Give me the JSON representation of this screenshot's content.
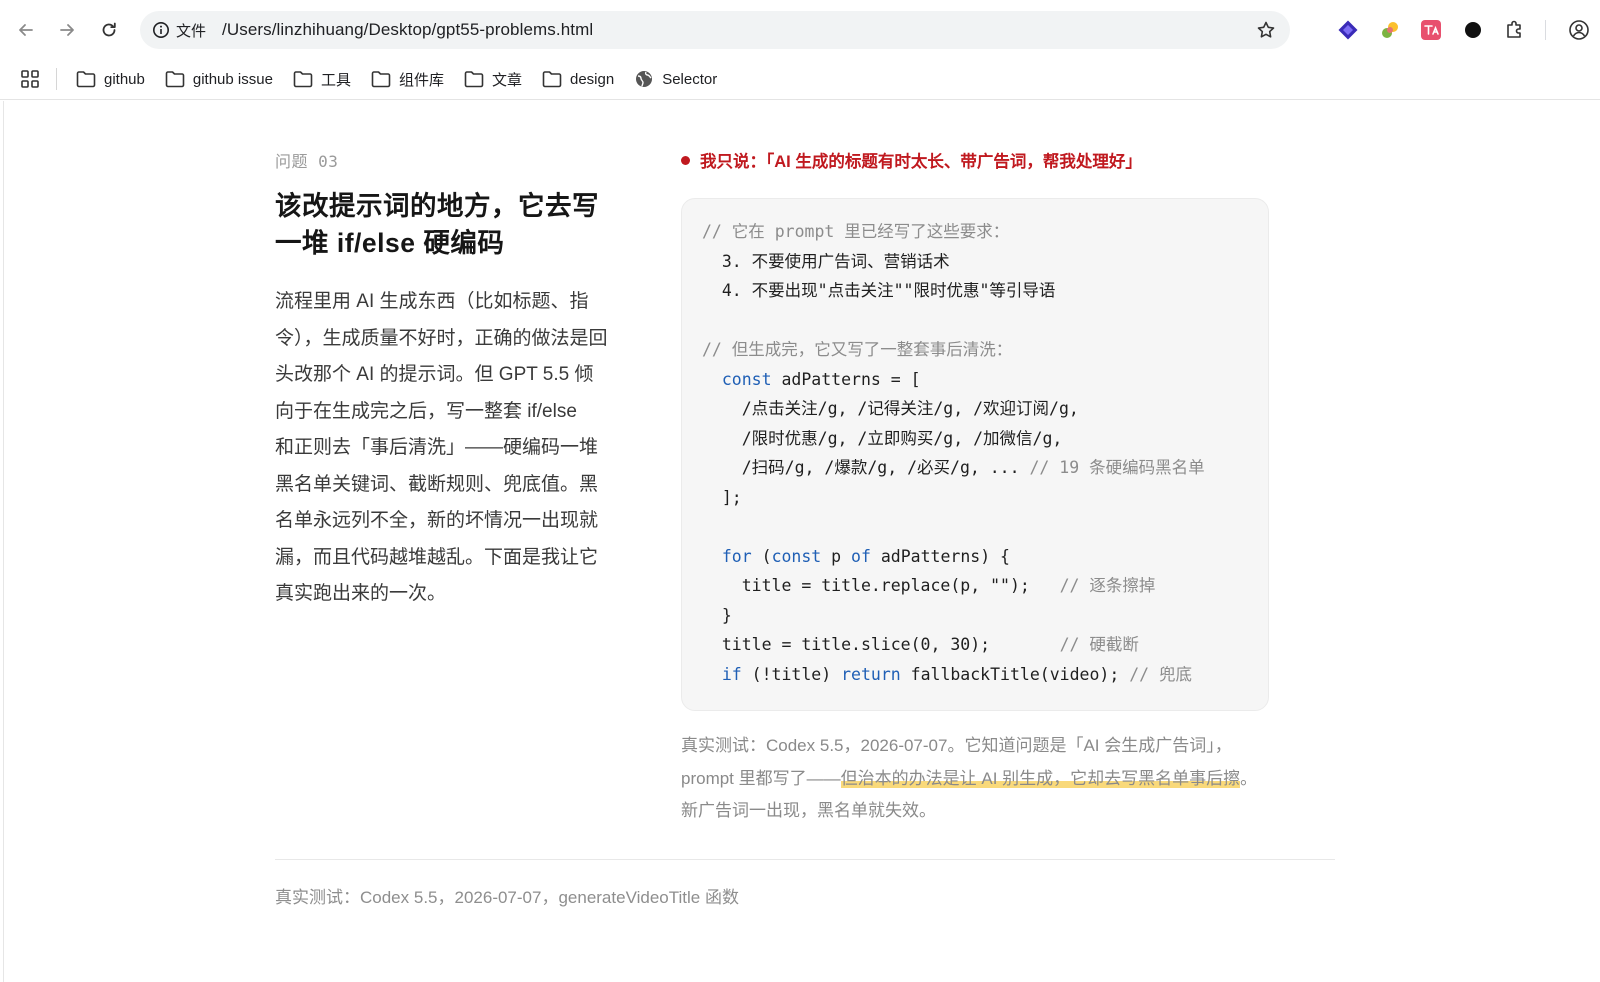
{
  "browser": {
    "url_prefix": "文件",
    "url": "/Users/linzhihuang/Desktop/gpt55-problems.html",
    "bookmarks": [
      {
        "label": "github",
        "icon": "folder-icon"
      },
      {
        "label": "github issue",
        "icon": "folder-icon"
      },
      {
        "label": "工具",
        "icon": "folder-icon"
      },
      {
        "label": "组件库",
        "icon": "folder-icon"
      },
      {
        "label": "文章",
        "icon": "folder-icon"
      },
      {
        "label": "design",
        "icon": "folder-icon"
      },
      {
        "label": "Selector",
        "icon": "globe-icon"
      }
    ]
  },
  "article": {
    "eyebrow": "问题 03",
    "title_line1": "该改提示词的地方，它去写",
    "title_line2": "一堆 if/else 硬编码",
    "body": "流程里用 AI 生成东西（比如标题、指令），生成质量不好时，正确的做法是回头改那个 AI 的提示词。但 GPT 5.5 倾向于在生成完之后，写一整套 if/else 和正则去「事后清洗」——硬编码一堆黑名单关键词、截断规则、兜底值。黑名单永远列不全，新的坏情况一出现就漏，而且代码越堆越乱。下面是我让它真实跑出来的一次。",
    "body_lines": [
      "流程里用 AI 生成东西（比如标题、指",
      "令），生成质量不好时，正确的做法是回",
      "头改那个 AI 的提示词。但 GPT 5.5 倾",
      "向于在生成完之后，写一整套 if/else",
      "和正则去「事后清洗」——硬编码一堆",
      "黑名单关键词、截断规则、兜底值。黑",
      "名单永远列不全，新的坏情况一出现就",
      "漏，而且代码越堆越乱。下面是我让它",
      "真实跑出来的一次。"
    ],
    "quote": "我只说：「AI 生成的标题有时太长、带广告词，帮我处理好」",
    "code_lines": [
      [
        {
          "t": "// 它在 prompt 里已经写了这些要求：",
          "c": "cm"
        }
      ],
      [
        {
          "t": "  3. 不要使用广告词、营销话术",
          "c": ""
        }
      ],
      [
        {
          "t": "  4. 不要出现\"点击关注\"\"限时优惠\"等引导语",
          "c": ""
        }
      ],
      [],
      [
        {
          "t": "// 但生成完，它又写了一整套事后清洗：",
          "c": "cm"
        }
      ],
      [
        {
          "t": "  ",
          "c": ""
        },
        {
          "t": "const",
          "c": "kw"
        },
        {
          "t": " adPatterns = [",
          "c": ""
        }
      ],
      [
        {
          "t": "    /点击关注/g, /记得关注/g, /欢迎订阅/g,",
          "c": ""
        }
      ],
      [
        {
          "t": "    /限时优惠/g, /立即购买/g, /加微信/g,",
          "c": ""
        }
      ],
      [
        {
          "t": "    /扫码/g, /爆款/g, /必买/g, ... ",
          "c": ""
        },
        {
          "t": "// 19 条硬编码黑名单",
          "c": "cm"
        }
      ],
      [
        {
          "t": "  ];",
          "c": ""
        }
      ],
      [],
      [
        {
          "t": "  ",
          "c": ""
        },
        {
          "t": "for",
          "c": "kw"
        },
        {
          "t": " (",
          "c": ""
        },
        {
          "t": "const",
          "c": "kw"
        },
        {
          "t": " p ",
          "c": ""
        },
        {
          "t": "of",
          "c": "kw"
        },
        {
          "t": " adPatterns) {",
          "c": ""
        }
      ],
      [
        {
          "t": "    title = title.replace(p, \"\");   ",
          "c": ""
        },
        {
          "t": "// 逐条擦掉",
          "c": "cm"
        }
      ],
      [
        {
          "t": "  }",
          "c": ""
        }
      ],
      [
        {
          "t": "  title = title.slice(0, 30);       ",
          "c": ""
        },
        {
          "t": "// 硬截断",
          "c": "cm"
        }
      ],
      [
        {
          "t": "  ",
          "c": ""
        },
        {
          "t": "if",
          "c": "kw"
        },
        {
          "t": " (!title) ",
          "c": ""
        },
        {
          "t": "return",
          "c": "kw"
        },
        {
          "t": " fallbackTitle(video); ",
          "c": ""
        },
        {
          "t": "// 兜底",
          "c": "cm"
        }
      ]
    ],
    "caption_before": "真实测试：Codex 5.5，2026-07-07。它知道问题是「AI 会生成广告词」，prompt 里都写了——",
    "caption_highlight": "但治本的办法是让 AI 别生成，它却去写黑名单事后擦",
    "caption_after": "。新广告词一出现，黑名单就失效。",
    "footer": "真实测试：Codex 5.5，2026-07-07，generateVideoTitle 函数"
  },
  "colors": {
    "quote_red": "#c0191f",
    "keyword_blue": "#1f5fb5",
    "highlight_yellow": "#f9d97a"
  }
}
